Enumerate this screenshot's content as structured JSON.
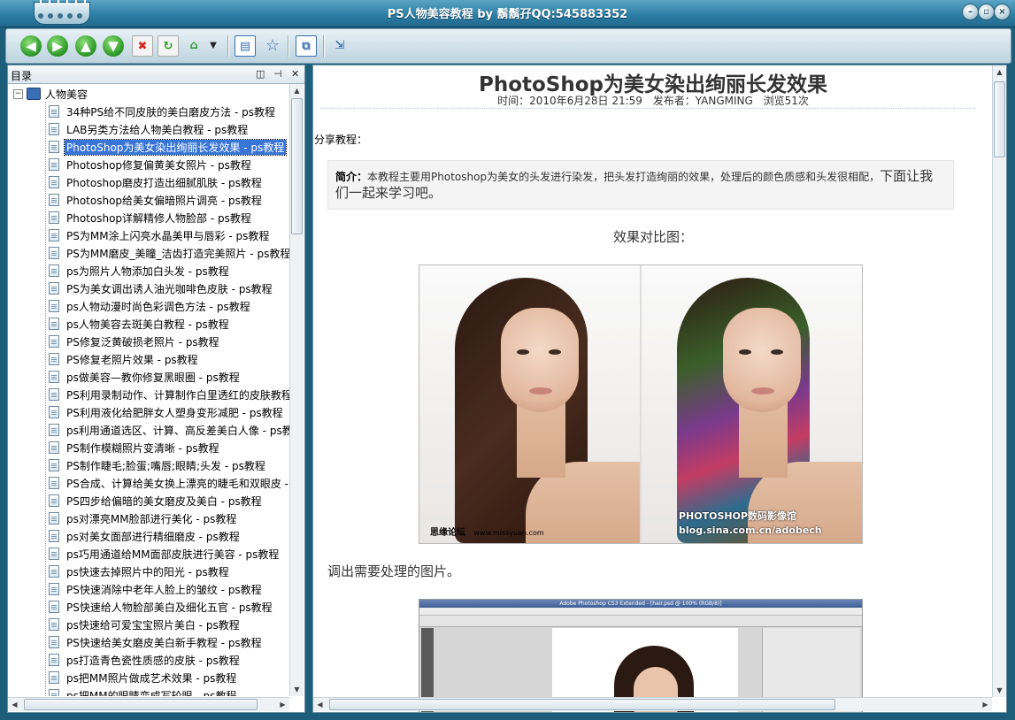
{
  "window": {
    "title": "PS人物美容教程 by 鬍鬍孖QQ:545883352"
  },
  "toolbar": {
    "buttons": [
      {
        "name": "back",
        "icon": "arrow-left-icon",
        "color": "#2f9a2a"
      },
      {
        "name": "forward",
        "icon": "arrow-right-icon",
        "color": "#2f9a2a"
      },
      {
        "name": "up",
        "icon": "arrow-up-icon",
        "color": "#2f9a2a"
      },
      {
        "name": "down",
        "icon": "arrow-down-icon",
        "color": "#2f9a2a"
      },
      {
        "name": "stop",
        "icon": "stop-icon",
        "color": "#d8261c"
      },
      {
        "name": "refresh",
        "icon": "refresh-icon",
        "color": "#2f9a2a"
      },
      {
        "name": "home",
        "icon": "home-icon",
        "color": "#2f9a2a"
      },
      {
        "name": "toc",
        "icon": "toc-panel-icon",
        "color": "#3a6fb0"
      },
      {
        "name": "favorites",
        "icon": "star-icon",
        "color": "#3a6fb0"
      },
      {
        "name": "window",
        "icon": "window-icon",
        "color": "#3a6fb0"
      },
      {
        "name": "exit",
        "icon": "exit-icon",
        "color": "#3a6fb0"
      }
    ]
  },
  "sidebar": {
    "title": "目录",
    "root_label": "人物美容",
    "items": [
      {
        "label": "34种PS给不同皮肤的美白磨皮方法 - ps教程"
      },
      {
        "label": "LAB另类方法给人物美白教程 - ps教程"
      },
      {
        "label": "PhotoShop为美女染出绚丽长发效果 - ps教程",
        "selected": true
      },
      {
        "label": "Photoshop修复偏黄美女照片 - ps教程"
      },
      {
        "label": "Photoshop磨皮打造出细腻肌肤 - ps教程"
      },
      {
        "label": "Photoshop给美女偏暗照片调亮 - ps教程"
      },
      {
        "label": "Photoshop详解精修人物脸部 - ps教程"
      },
      {
        "label": "PS为MM涂上闪亮水晶美甲与唇彩 - ps教程"
      },
      {
        "label": "PS为MM磨皮_美瞳_洁齿打造完美照片 - ps教程"
      },
      {
        "label": "ps为照片人物添加白头发 - ps教程"
      },
      {
        "label": "PS为美女调出诱人油光咖啡色皮肤 - ps教程"
      },
      {
        "label": "ps人物动漫时尚色彩调色方法 - ps教程"
      },
      {
        "label": "ps人物美容去斑美白教程 - ps教程"
      },
      {
        "label": "PS修复泛黄破损老照片 - ps教程"
      },
      {
        "label": "PS修复老照片效果 - ps教程"
      },
      {
        "label": "ps做美容—教你修复黑眼圈 - ps教程"
      },
      {
        "label": "PS利用录制动作、计算制作白里透红的皮肤教程"
      },
      {
        "label": "PS利用液化给肥胖女人塑身变形减肥 - ps教程"
      },
      {
        "label": "ps利用通道选区、计算、高反差美白人像 - ps教"
      },
      {
        "label": "PS制作模糊照片变清晰 - ps教程"
      },
      {
        "label": "PS制作睫毛;脸蛋;嘴唇;眼睛;头发 - ps教程"
      },
      {
        "label": "PS合成、计算给美女换上漂亮的睫毛和双眼皮 -"
      },
      {
        "label": "PS四步给偏暗的美女磨皮及美白 - ps教程"
      },
      {
        "label": "ps对漂亮MM脸部进行美化 - ps教程"
      },
      {
        "label": "ps对美女面部进行精细磨皮 - ps教程"
      },
      {
        "label": "ps巧用通道给MM面部皮肤进行美容 - ps教程"
      },
      {
        "label": "ps快速去掉照片中的阳光 - ps教程"
      },
      {
        "label": "PS快速消除中老年人脸上的皱纹 - ps教程"
      },
      {
        "label": "PS快速给人物脸部美白及细化五官 - ps教程"
      },
      {
        "label": "ps快速给可爱宝宝照片美白 - ps教程"
      },
      {
        "label": "PS快速给美女磨皮美白新手教程 - ps教程"
      },
      {
        "label": "ps打造青色瓷性质感的皮肤 - ps教程"
      },
      {
        "label": "ps把MM照片做成艺术效果 - ps教程"
      },
      {
        "label": "ps把MM的眼睛变成写轮眼 - ps教程"
      }
    ]
  },
  "article": {
    "title": "PhotoShop为美女染出绚丽长发效果",
    "time_label": "时间：2010年6月28日  21:59",
    "author_label": "发布者：YANGMING",
    "views_label": "浏览51次",
    "share_label": "分享教程：",
    "intro_label": "简介：",
    "intro_text": "本教程主要用Photoshop为美女的头发进行染发，把头发打造绚丽的效果，处理后的颜色质感和头发很相配，",
    "intro_text_big": "下面让我们一起来学习吧。",
    "compare_heading": "效果对比图：",
    "watermark_left": "思缘论坛",
    "watermark_left_url": "www.missyuan.com",
    "watermark_right_line1": "PHOTOSHOP数码影像馆",
    "watermark_right_line2": "blog.sina.com.cn/adobech",
    "step1": "调出需要处理的图片。",
    "screenshot_title": "Adobe Photoshop CS3 Extended - [hair.psd @ 100% (RGB/8)]"
  }
}
